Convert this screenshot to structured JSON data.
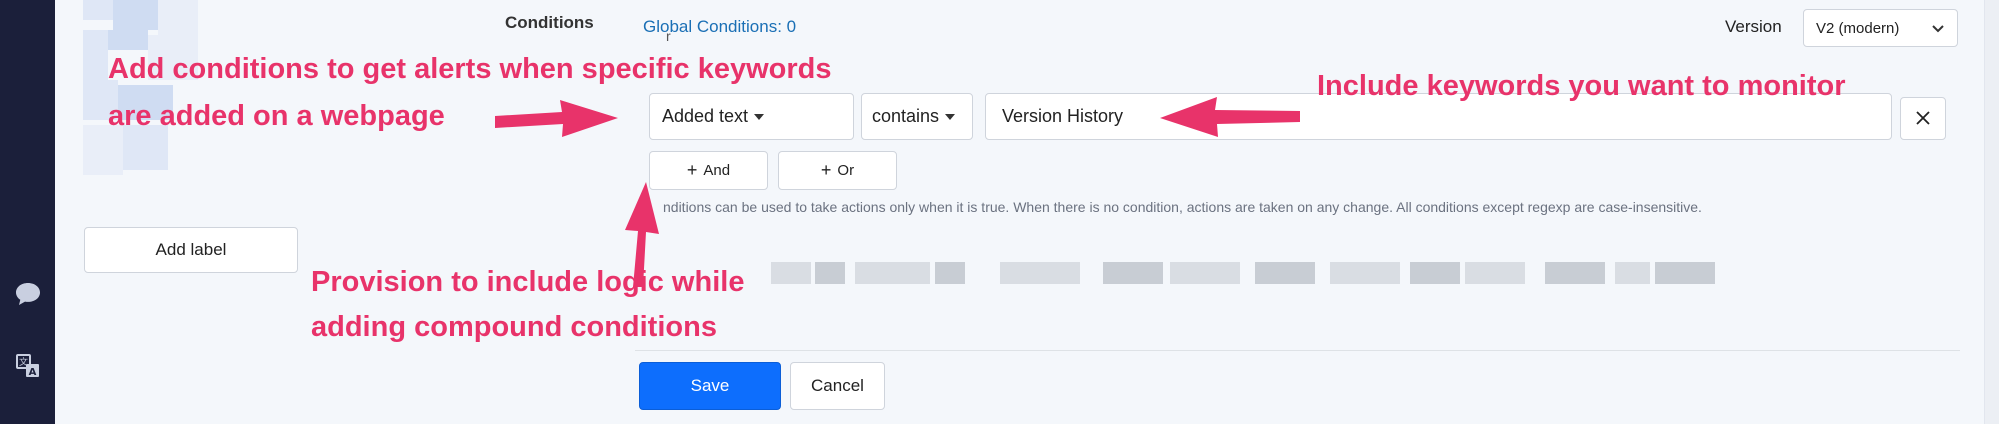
{
  "sidebar": {
    "icons": [
      {
        "name": "chat-bubble-icon"
      },
      {
        "name": "translate-icon"
      }
    ]
  },
  "conditions": {
    "label": "Conditions",
    "global_link": "Global Conditions: 0",
    "clipped_char": "r",
    "version_label": "Version",
    "version_value": "V2 (modern)",
    "rule": {
      "type": "Added text",
      "operator": "contains",
      "value": "Version History"
    },
    "and_button": "And",
    "or_button": "Or",
    "hint": "nditions can be used to take actions only when it is true. When there is no condition, actions are taken on any change. All conditions except regexp are case-insensitive."
  },
  "add_label_button": "Add label",
  "footer": {
    "save": "Save",
    "cancel": "Cancel"
  },
  "annotations": {
    "a1_line1": "Add conditions to get alerts when specific keywords",
    "a1_line2": "are added on a webpage",
    "a2": "Include keywords you want to monitor",
    "a3_line1": "Provision to include logic while",
    "a3_line2": "adding compound conditions"
  },
  "colors": {
    "annotation": "#e8336a",
    "primary": "#0d6efd",
    "link": "#1a6fb5"
  }
}
